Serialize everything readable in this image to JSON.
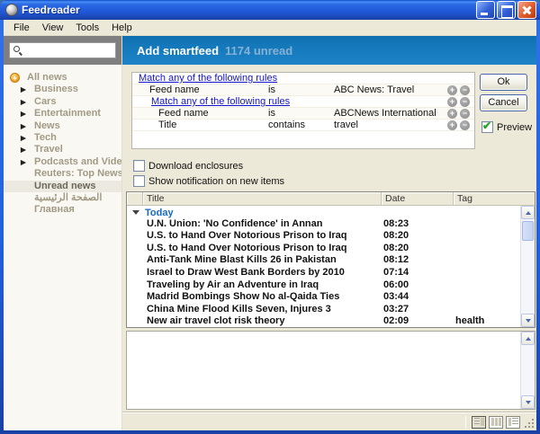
{
  "window": {
    "title": "Feedreader"
  },
  "menu": {
    "items": [
      "File",
      "View",
      "Tools",
      "Help"
    ]
  },
  "sidebar": {
    "search_value": "",
    "items": [
      {
        "label": "All news"
      },
      {
        "label": "Business"
      },
      {
        "label": "Cars"
      },
      {
        "label": "Entertainment"
      },
      {
        "label": "News"
      },
      {
        "label": "Tech"
      },
      {
        "label": "Travel"
      },
      {
        "label": "Podcasts and Videoc..."
      },
      {
        "label": "Reuters: Top News"
      },
      {
        "label": "Unread news"
      },
      {
        "label": "الصفحة الرئيسية"
      },
      {
        "label": "Главная"
      }
    ]
  },
  "header": {
    "title": "Add smartfeed",
    "unread_badge": "1174 unread"
  },
  "smartfeed": {
    "rules": [
      {
        "kind": "group",
        "label": "Match any of the following rules"
      },
      {
        "kind": "rule",
        "field": "Feed name",
        "operator": "is",
        "value": "ABC News: Travel"
      },
      {
        "kind": "group",
        "label": "Match any of the following rules"
      },
      {
        "kind": "rule",
        "field": "Feed name",
        "operator": "is",
        "value": "ABCNews International"
      },
      {
        "kind": "rule",
        "field": "Title",
        "operator": "contains",
        "value": "travel"
      }
    ],
    "ok_label": "Ok",
    "cancel_label": "Cancel",
    "preview_label": "Preview",
    "preview_checked": true,
    "options": [
      {
        "label": "Download enclosures",
        "checked": false
      },
      {
        "label": "Show notification on new items",
        "checked": false
      }
    ]
  },
  "news_list": {
    "columns": [
      "Title",
      "Date",
      "Tag"
    ],
    "group_label": "Today",
    "items": [
      {
        "title": "U.N. Union: 'No Confidence' in Annan",
        "date": "08:23",
        "tag": ""
      },
      {
        "title": "U.S. to Hand Over Notorious Prison to Iraq",
        "date": "08:20",
        "tag": ""
      },
      {
        "title": "U.S. to Hand Over Notorious Prison to Iraq",
        "date": "08:20",
        "tag": ""
      },
      {
        "title": "Anti-Tank Mine Blast Kills 26 in Pakistan",
        "date": "08:12",
        "tag": ""
      },
      {
        "title": "Israel to Draw West Bank Borders by 2010",
        "date": "07:14",
        "tag": ""
      },
      {
        "title": "Traveling by Air an Adventure in Iraq",
        "date": "06:00",
        "tag": ""
      },
      {
        "title": "Madrid Bombings Show No al-Qaida Ties",
        "date": "03:44",
        "tag": ""
      },
      {
        "title": "China Mine Flood Kills Seven, Injures 3",
        "date": "03:27",
        "tag": ""
      },
      {
        "title": "New air travel clot risk theory",
        "date": "02:09",
        "tag": "health"
      }
    ]
  },
  "colors": {
    "titlebar_blue": "#2360DE",
    "header_blue_top": "#0E6FB0",
    "header_blue_bottom": "#1E84C8",
    "unread_text": "#86B1D4",
    "link_blue": "#1414CC",
    "sidebar_text": "#A29A85",
    "group_blue": "#1569C7",
    "check_green": "#23A423"
  }
}
